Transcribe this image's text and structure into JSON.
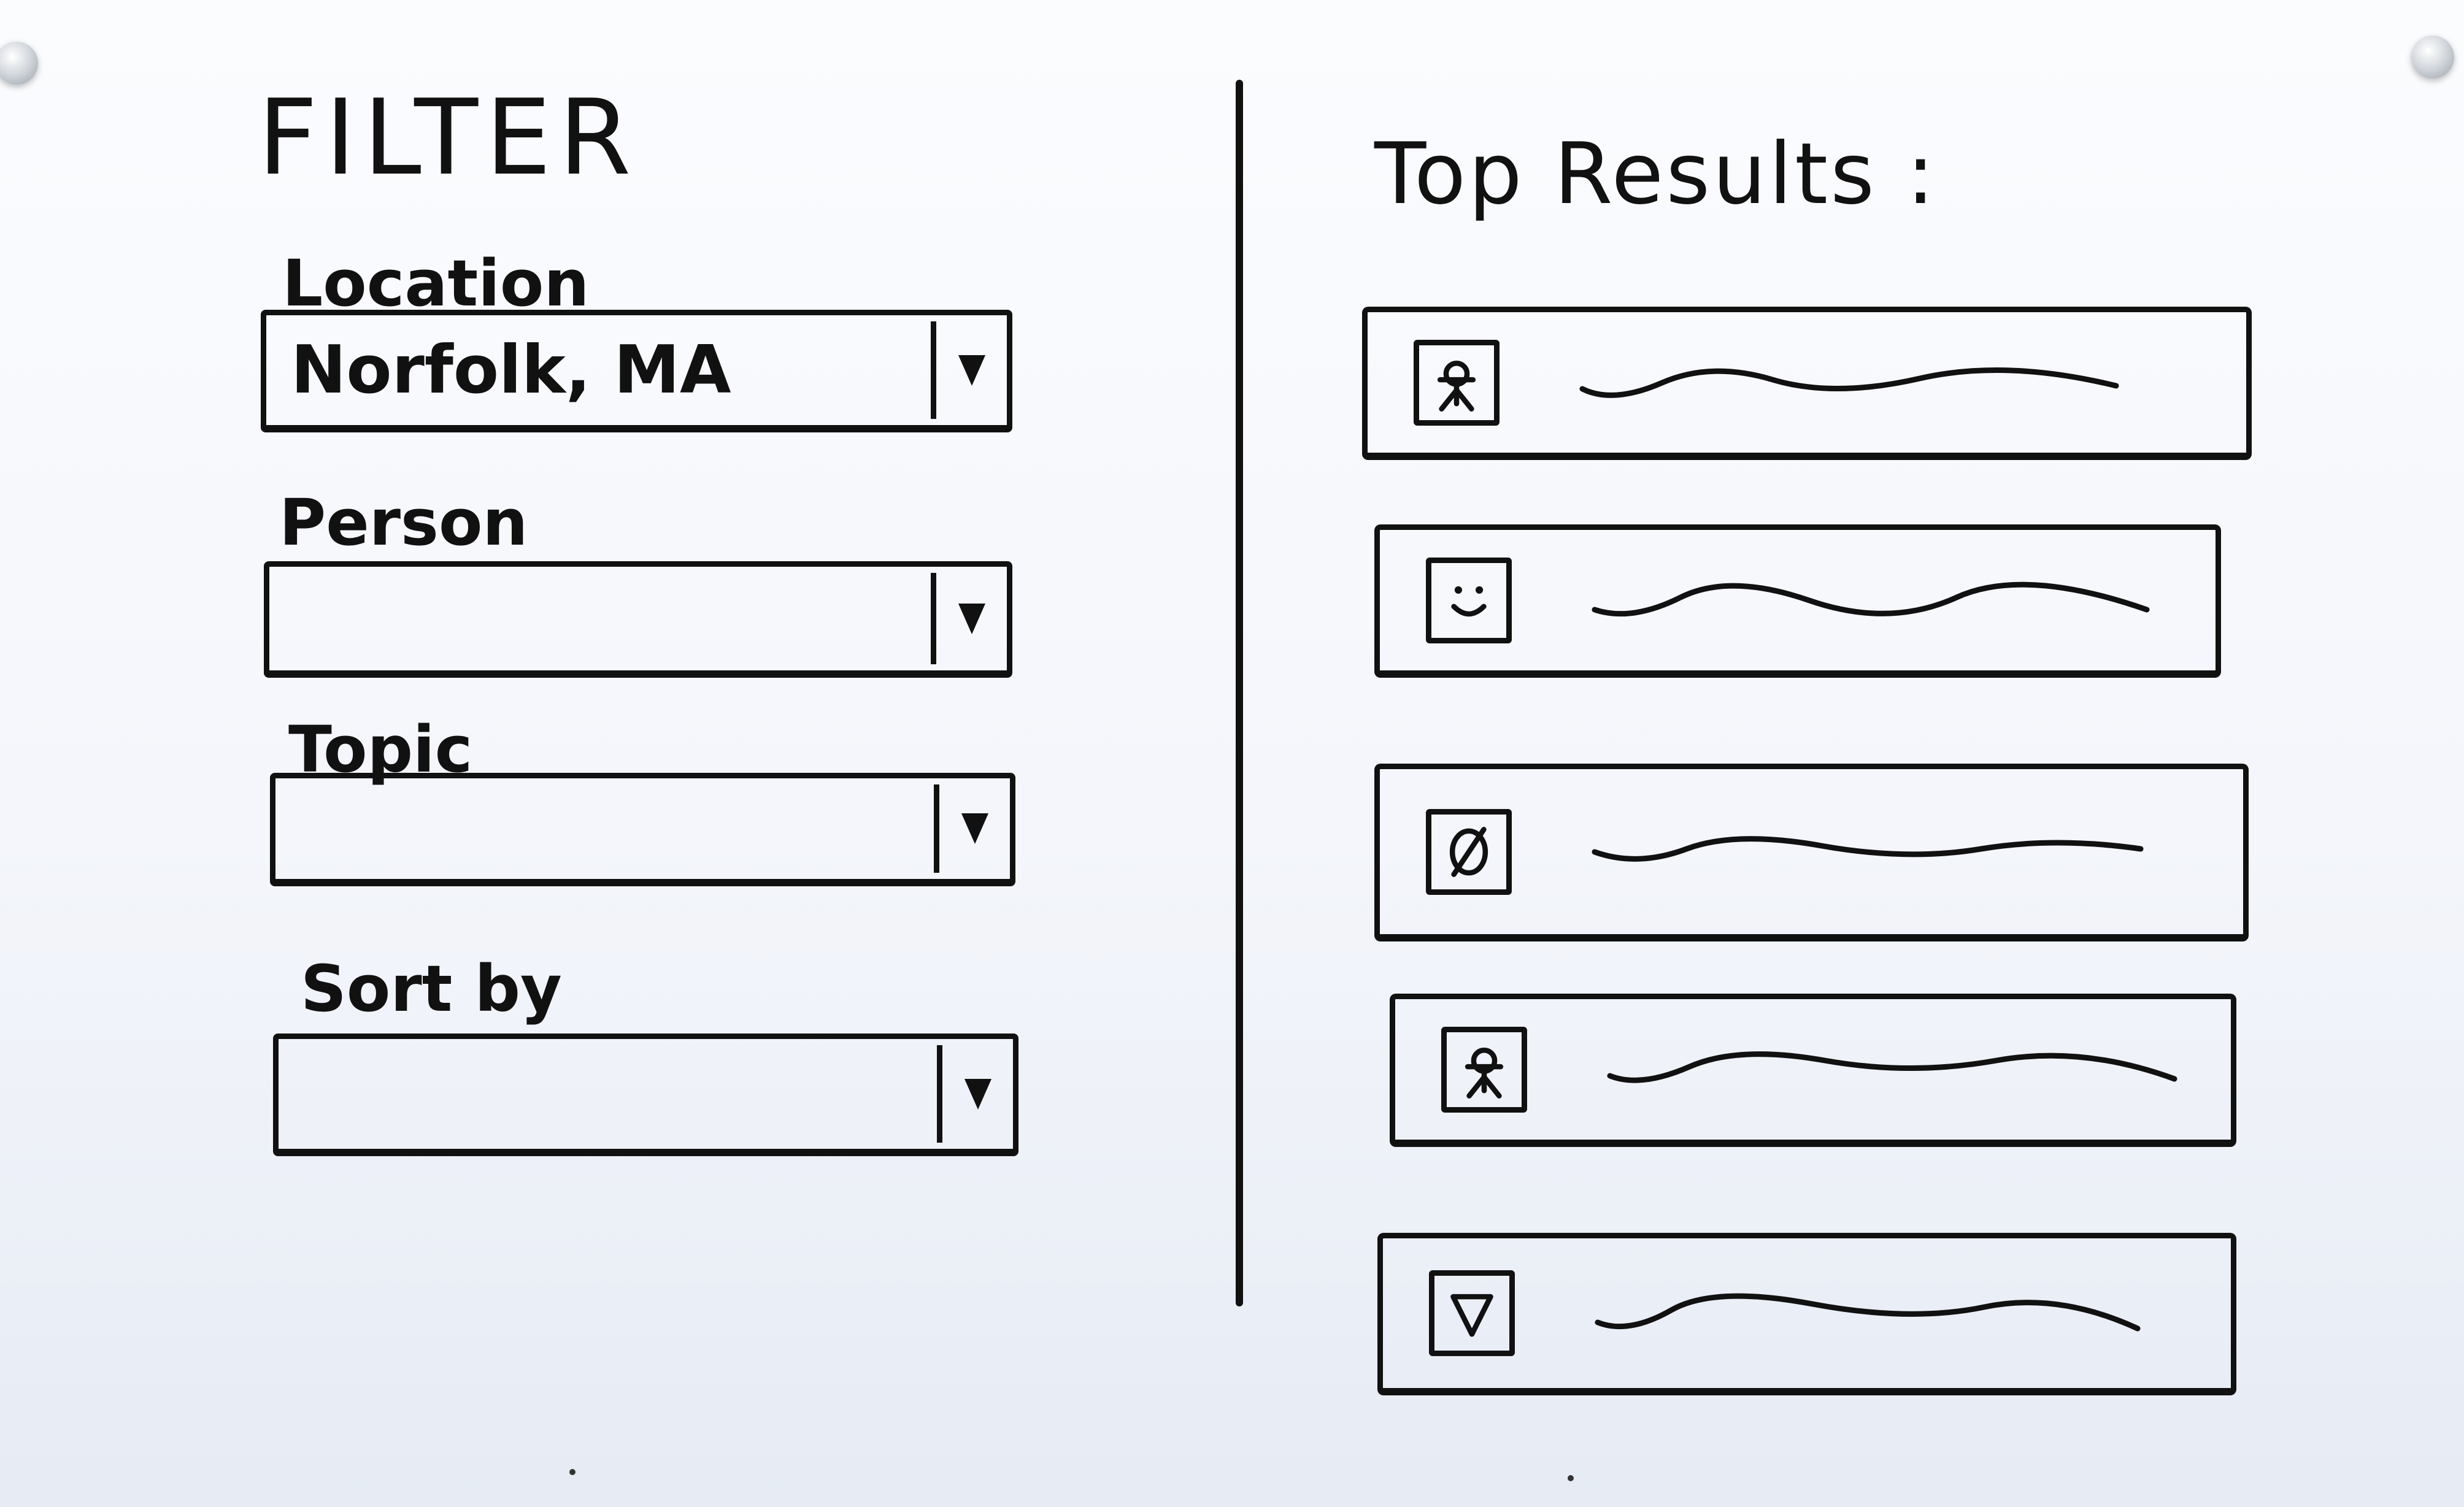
{
  "filter": {
    "title": "FILTER",
    "fields": [
      {
        "label": "Location",
        "value": "Norfolk, MA"
      },
      {
        "label": "Person",
        "value": ""
      },
      {
        "label": "Topic",
        "value": ""
      },
      {
        "label": "Sort by",
        "value": ""
      }
    ]
  },
  "results": {
    "title": "Top Results :",
    "items": [
      {
        "thumbnail_icon": "person-icon"
      },
      {
        "thumbnail_icon": "smiley-face-icon"
      },
      {
        "thumbnail_icon": "empty-set-icon"
      },
      {
        "thumbnail_icon": "person-icon"
      },
      {
        "thumbnail_icon": "down-triangle-icon"
      }
    ]
  }
}
